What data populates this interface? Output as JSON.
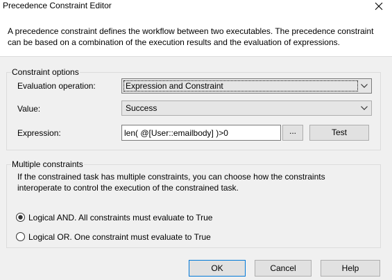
{
  "window": {
    "title": "Precedence Constraint Editor",
    "close_icon": "close-icon"
  },
  "intro": {
    "text": "A precedence constraint defines the workflow between two executables. The precedence constraint can be based on a combination of the execution results and the evaluation of expressions."
  },
  "constraint_options": {
    "legend": "Constraint options",
    "evaluation_operation": {
      "label": "Evaluation operation:",
      "value": "Expression and Constraint"
    },
    "value": {
      "label": "Value:",
      "value": "Success"
    },
    "expression": {
      "label": "Expression:",
      "value": "len( @[User::emailbody] )>0",
      "browse_label": "...",
      "test_label": "Test"
    }
  },
  "multiple_constraints": {
    "legend": "Multiple constraints",
    "description": "If the constrained task has multiple constraints, you can choose how the constraints interoperate to control the execution of the constrained task.",
    "options": [
      {
        "label": "Logical AND. All constraints must evaluate to True",
        "selected": true
      },
      {
        "label": "Logical OR. One constraint must evaluate to True",
        "selected": false
      }
    ]
  },
  "buttons": {
    "ok": "OK",
    "cancel": "Cancel",
    "help": "Help"
  },
  "colors": {
    "dialog_bg": "#f0f0f0",
    "default_button_border": "#0078d7"
  }
}
